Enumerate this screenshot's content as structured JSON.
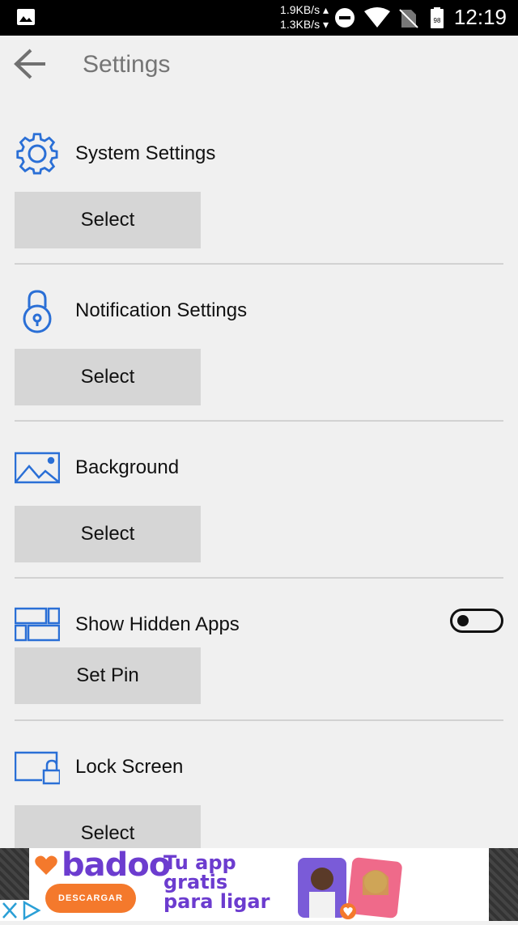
{
  "status_bar": {
    "speed_up": "1.9KB/s",
    "speed_down": "1.3KB/s",
    "time": "12:19",
    "battery_level": "98",
    "icons": [
      "image-icon",
      "dnd-icon",
      "wifi-icon",
      "no-sim-icon",
      "battery-icon"
    ]
  },
  "header": {
    "title": "Settings",
    "back_icon": "arrow-left-icon"
  },
  "sections": [
    {
      "label": "System Settings",
      "button": "Select",
      "icon": "gear-icon"
    },
    {
      "label": "Notification Settings",
      "button": "Select",
      "icon": "lock-icon"
    },
    {
      "label": "Background",
      "button": "Select",
      "icon": "image-icon"
    },
    {
      "label": "Show Hidden Apps",
      "button": "Set Pin",
      "icon": "grid-icon",
      "toggle_on": false
    },
    {
      "label": "Lock Screen",
      "button": "Select",
      "icon": "screen-lock-icon"
    }
  ],
  "ad": {
    "brand": "badoo",
    "cta": "DESCARGAR",
    "tagline_1": "Tu app",
    "tagline_2": "gratis",
    "tagline_3": "para ligar"
  },
  "colors": {
    "accent_blue": "#2a6fd6",
    "button_bg": "#d6d6d6",
    "background": "#f0f0f0",
    "ad_purple": "#6c3ccf",
    "ad_orange": "#f4792c"
  }
}
